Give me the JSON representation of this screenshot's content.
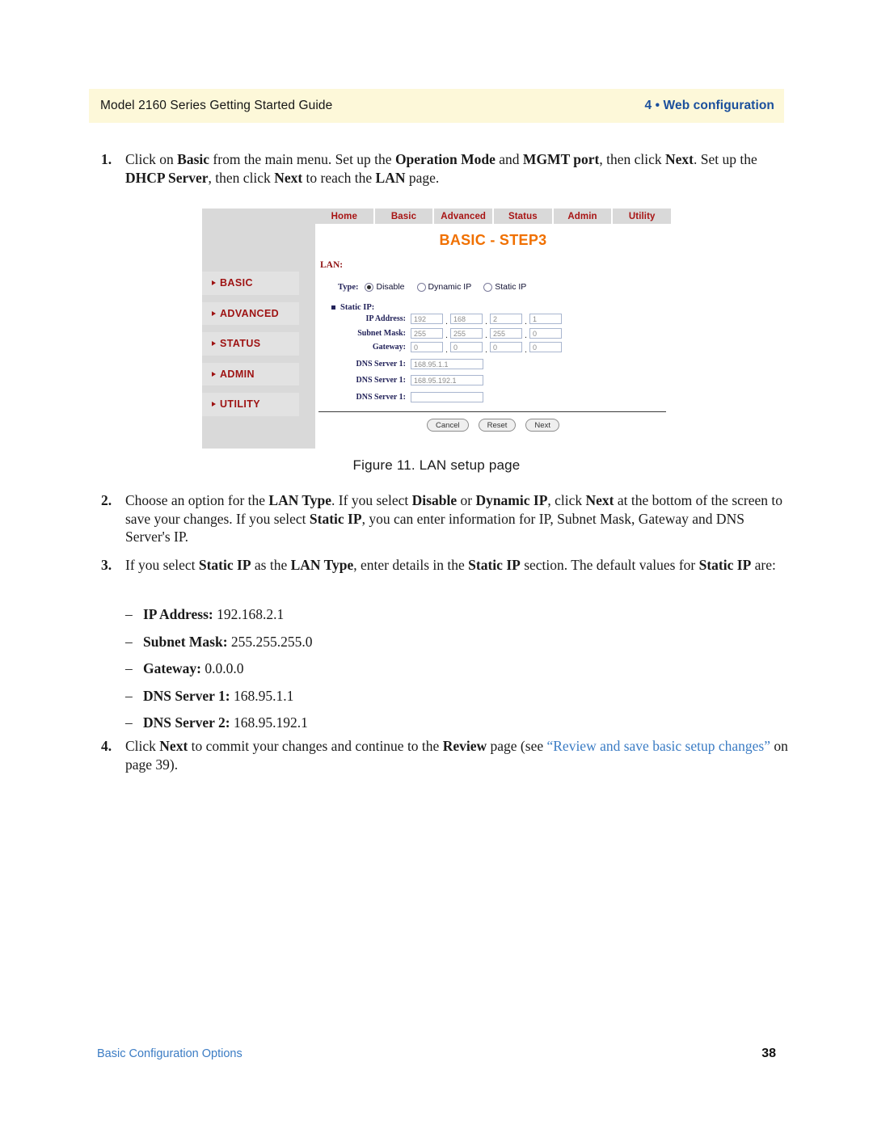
{
  "header": {
    "left": "Model 2160 Series Getting Started Guide",
    "right": "4 • Web configuration"
  },
  "steps": [
    {
      "number": "1.",
      "text_html": "Click on <b>Basic</b> from the main menu. Set up the <b>Operation Mode</b> and <b>MGMT port</b>, then click <b>Next</b>. Set up the <b>DHCP Server</b>, then click <b>Next</b> to reach the <b>LAN</b> page."
    },
    {
      "number": "2.",
      "text_html": "Choose an option for the <b>LAN Type</b>. If you select <b>Disable</b> or <b>Dynamic IP</b>, click <b>Next</b> at the bottom of the screen to save your changes. If you select <b>Static IP</b>, you can enter information for IP, Subnet Mask, Gateway and DNS Server's IP."
    },
    {
      "number": "3.",
      "text_html": "If you select <b>Static IP</b> as the <b>LAN Type</b>, enter details in the <b>Static IP</b> section. The default values for <b>Static IP</b> are:"
    },
    {
      "number": "4.",
      "text_html": "Click <b>Next</b> to commit your changes and continue to the <b>Review</b> page (see <span class=\"xref\">“Review and save basic setup changes”</span> on page 39)."
    }
  ],
  "defaults_list": [
    {
      "dash": "–",
      "label": "IP Address:",
      "value": "192.168.2.1"
    },
    {
      "dash": "–",
      "label": "Subnet Mask:",
      "value": "255.255.255.0"
    },
    {
      "dash": "–",
      "label": "Gateway:",
      "value": "0.0.0.0"
    },
    {
      "dash": "–",
      "label": "DNS Server 1:",
      "value": "168.95.1.1"
    },
    {
      "dash": "–",
      "label": "DNS Server 2:",
      "value": "168.95.192.1"
    }
  ],
  "figure": {
    "caption": "Figure 11. LAN setup page",
    "nav_tabs": [
      "Home",
      "Basic",
      "Advanced",
      "Status",
      "Admin",
      "Utility"
    ],
    "sidebar_items": [
      "BASIC",
      "ADVANCED",
      "STATUS",
      "ADMIN",
      "UTILITY"
    ],
    "title": "BASIC - STEP3",
    "lan_heading": "LAN:",
    "type_label": "Type:",
    "type_options": [
      {
        "label": "Disable",
        "selected": true
      },
      {
        "label": "Dynamic IP",
        "selected": false
      },
      {
        "label": "Static IP",
        "selected": false
      }
    ],
    "static_ip_heading": "Static IP:",
    "octet_rows": [
      {
        "label": "IP Address:",
        "octets": [
          "192",
          "168",
          "2",
          "1"
        ]
      },
      {
        "label": "Subnet Mask:",
        "octets": [
          "255",
          "255",
          "255",
          "0"
        ]
      },
      {
        "label": "Gateway:",
        "octets": [
          "0",
          "0",
          "0",
          "0"
        ]
      }
    ],
    "dns_rows": [
      {
        "label": "DNS Server 1:",
        "value": "168.95.1.1"
      },
      {
        "label": "DNS Server 1:",
        "value": "168.95.192.1"
      },
      {
        "label": "DNS Server 1:",
        "value": ""
      }
    ],
    "buttons": [
      "Cancel",
      "Reset",
      "Next"
    ]
  },
  "footer": {
    "left": "Basic Configuration Options",
    "page_number": "38"
  },
  "colors": {
    "header_band": "#fdf8d9",
    "header_accent": "#1a4f9c",
    "xref_blue": "#3b7cc4",
    "menu_red": "#9e1212",
    "title_orange": "#f07000",
    "sidebar_gray": "#d9d9d9"
  }
}
